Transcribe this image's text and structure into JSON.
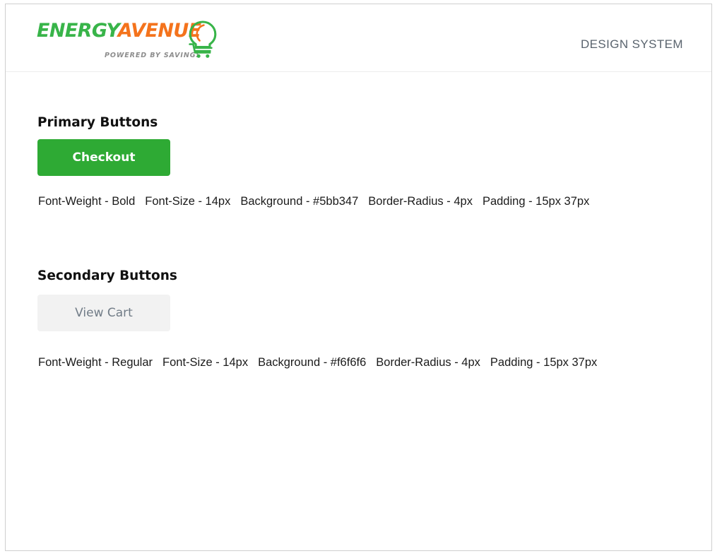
{
  "header": {
    "logo": {
      "word_part_1": "ENERGY",
      "word_part_2": "AVENUE",
      "tagline": "POWERED BY SAVINGS",
      "icon_name": "lightbulb-cart-icon",
      "green": "#38b449",
      "orange": "#f4731c",
      "tagline_color": "#8d8d8d"
    },
    "title": "DESIGN SYSTEM",
    "title_color": "#5a646e"
  },
  "sections": [
    {
      "title": "Primary Buttons",
      "button_label": "Checkout",
      "specs": [
        "Font-Weight - Bold",
        "Font-Size - 14px",
        "Background - #5bb347",
        "Border-Radius - 4px",
        "Padding - 15px 37px"
      ],
      "spec_text": "Font-Weight - Bold  Font-Size - 14px  Background - #5bb347  Border-Radius - 4px  Padding - 15px 37px",
      "background": "#5bb347",
      "text_color": "#ffffff",
      "font_weight": "Bold",
      "font_size": "14px",
      "border_radius": "4px",
      "padding": "15px 37px"
    },
    {
      "title": "Secondary Buttons",
      "button_label": "View Cart",
      "specs": [
        "Font-Weight - Regular",
        "Font-Size - 14px",
        "Background - #f6f6f6",
        "Border-Radius - 4px",
        "Padding - 15px 37px"
      ],
      "spec_text": "Font-Weight - Regular  Font-Size - 14px  Background - #f6f6f6  Border-Radius - 4px  Padding - 15px 37px",
      "background": "#f6f6f6",
      "text_color": "#717c87",
      "font_weight": "Regular",
      "font_size": "14px",
      "border_radius": "4px",
      "padding": "15px 37px"
    }
  ]
}
